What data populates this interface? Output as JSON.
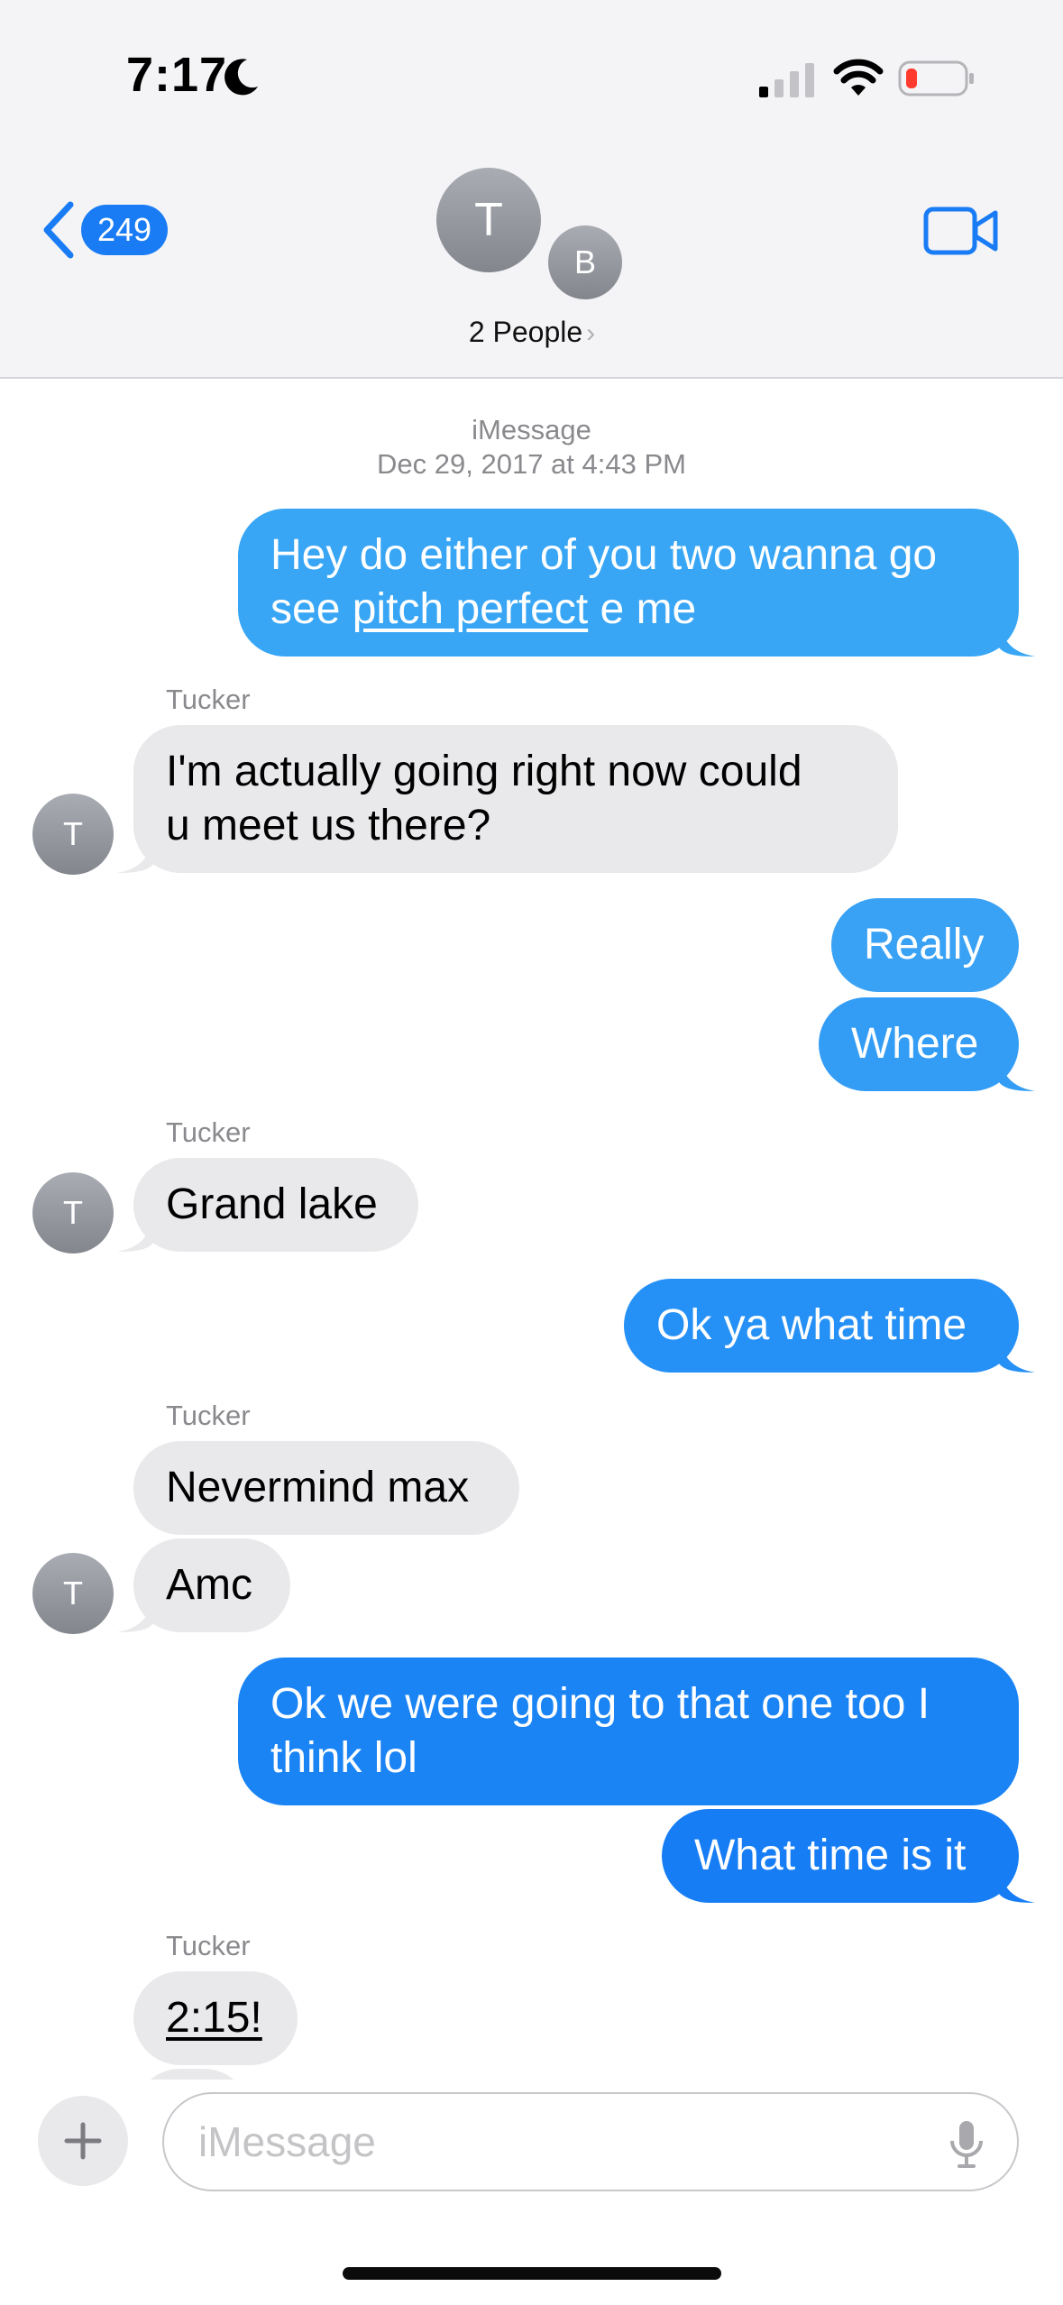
{
  "status_bar": {
    "time": "7:17"
  },
  "header": {
    "back_badge": "249",
    "avatar_primary_initial": "T",
    "avatar_secondary_initial": "B",
    "people_label": "2 People",
    "people_chevron": "›"
  },
  "thread": {
    "service_label": "iMessage",
    "timestamp": "Dec 29, 2017 at 4:43 PM",
    "messages": [
      {
        "direction": "out",
        "text_before": "Hey do either of you two wanna go\nsee ",
        "link": "pitch perfect",
        "text_after": " e me"
      },
      {
        "direction": "in",
        "sender": "Tucker",
        "text": "I'm actually going right now could\nu meet us there?"
      },
      {
        "direction": "out",
        "text": "Really"
      },
      {
        "direction": "out",
        "text": "Where"
      },
      {
        "direction": "in",
        "sender": "Tucker",
        "text": "Grand lake"
      },
      {
        "direction": "out",
        "text": "Ok ya what time"
      },
      {
        "direction": "in",
        "sender": "Tucker",
        "text": "Nevermind max"
      },
      {
        "direction": "in",
        "text": "Amc"
      },
      {
        "direction": "out",
        "text": "Ok we were going to that one too I\nthink lol"
      },
      {
        "direction": "out",
        "text": "What time is it"
      },
      {
        "direction": "in",
        "sender": "Tucker",
        "text": "2:15!"
      }
    ],
    "avatar_initial": "T"
  },
  "composer": {
    "placeholder": "iMessage"
  },
  "colors": {
    "bubble_out_light": "#38a6f5",
    "bubble_out_dark": "#1a7cf5",
    "bubble_in": "#e9e9eb",
    "accent": "#1a7cf5"
  },
  "icons": {
    "back": "chevron-left-icon",
    "video": "video-camera-icon",
    "plus": "plus-icon",
    "mic": "microphone-icon",
    "moon": "moon-icon",
    "signal": "cellular-signal-icon",
    "wifi": "wifi-icon",
    "battery": "battery-low-icon"
  }
}
